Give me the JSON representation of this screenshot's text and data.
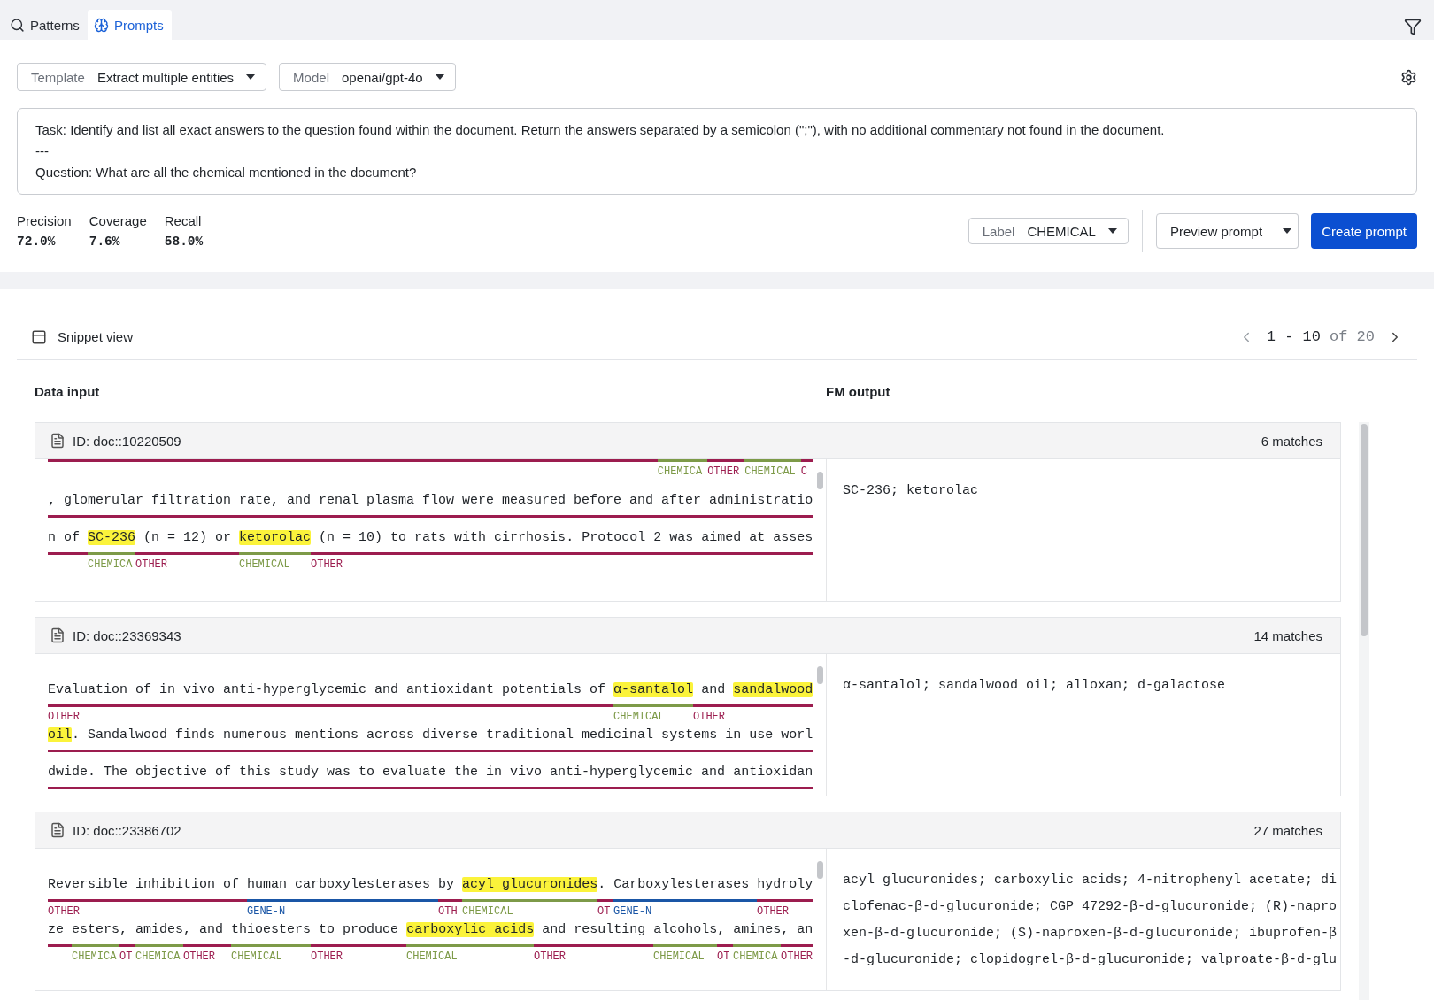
{
  "tabs": [
    {
      "label": "Patterns",
      "selected": false
    },
    {
      "label": "Prompts",
      "selected": true
    }
  ],
  "selectors": [
    {
      "label": "Template",
      "value": "Extract multiple entities"
    },
    {
      "label": "Model",
      "value": "openai/gpt-4o"
    }
  ],
  "prompt": {
    "lines": [
      "Task: Identify and list all exact answers to the question found within the document. Return the answers separated by a semicolon (\";\"), with no additional commentary not found in the document.",
      "---",
      "Question: What are all the chemical mentioned in the document?"
    ]
  },
  "metrics": [
    {
      "name": "Precision",
      "value": "72.0%"
    },
    {
      "name": "Coverage",
      "value": "7.6%"
    },
    {
      "name": "Recall",
      "value": "58.0%"
    }
  ],
  "label_selector": {
    "label": "Label",
    "value": "CHEMICAL"
  },
  "preview_button": "Preview prompt",
  "create_button": "Create prompt",
  "snippet_view": "Snippet view",
  "pagination": {
    "range": "1 - 10",
    "total": "of 20"
  },
  "columns": [
    "Data input",
    "FM output"
  ],
  "docs": [
    {
      "id": "ID: doc::10220509",
      "matches": "6 matches",
      "lines": [
        {
          "kind": "tags",
          "spans": [
            {
              "color": "#9c1d4f"
            },
            {
              "label": "CHEMICA",
              "color": "#7d9a48"
            },
            {
              "label": "OTHER",
              "color": "#9c1d4f"
            },
            {
              "label": "CHEMICAL",
              "color": "#7d9a48"
            },
            {
              "label": "C",
              "color": "#9c1d4f"
            }
          ]
        },
        {
          "kind": "text",
          "segments": [
            {
              "text": ", glomerular filtration rate, and renal plasma flow were measured before and after administratio",
              "color": "#9c1d4f",
              "highlight": false
            }
          ]
        },
        {
          "kind": "text",
          "segments": [
            {
              "text": "n of ",
              "color": "#9c1d4f",
              "highlight": false
            },
            {
              "text": "SC-236",
              "color": "#7d9a48",
              "label": "CHEMICA",
              "highlight": true
            },
            {
              "text": " (n = 12) or ",
              "color": "#9c1d4f",
              "label": "OTHER",
              "highlight": false
            },
            {
              "text": "ketorolac",
              "color": "#7d9a48",
              "label": "CHEMICAL",
              "highlight": true
            },
            {
              "text": " (n = 10) to rats with cirrhosis. Protocol 2 was aimed at asses",
              "color": "#9c1d4f",
              "label": "OTHER",
              "highlight": false
            }
          ]
        }
      ],
      "output": [
        "SC-236; ketorolac"
      ]
    },
    {
      "id": "ID: doc::23369343",
      "matches": "14 matches",
      "lines": [
        {
          "kind": "text",
          "segments": [
            {
              "text": "Evaluation of in vivo anti-hyperglycemic and antioxidant potentials of ",
              "color": "#9c1d4f",
              "label": "OTHER",
              "highlight": false
            },
            {
              "text": "α-santalol",
              "color": "#7d9a48",
              "label": "CHEMICAL",
              "highlight": true
            },
            {
              "text": " and ",
              "color": "#9c1d4f",
              "label": "OTHER",
              "highlight": false
            },
            {
              "text": "sandalwood",
              "color": "#9c1d4f",
              "highlight": true
            }
          ]
        },
        {
          "kind": "text",
          "segments": [
            {
              "text": "oil",
              "color": "#9c1d4f",
              "highlight": true
            },
            {
              "text": ". Sandalwood finds numerous mentions across diverse traditional medicinal systems in use worl",
              "color": "#9c1d4f",
              "highlight": false
            }
          ]
        },
        {
          "kind": "text",
          "segments": [
            {
              "text": "dwide. The objective of this study was to evaluate the in vivo anti-hyperglycemic and antioxidan",
              "color": "#9c1d4f",
              "highlight": false
            }
          ]
        }
      ],
      "output": [
        "α-santalol; sandalwood oil; alloxan; d-galactose"
      ]
    },
    {
      "id": "ID: doc::23386702",
      "matches": "27 matches",
      "lines": [
        {
          "kind": "text",
          "segments": [
            {
              "text": "Reversible inhibition of ",
              "color": "#9c1d4f",
              "label": "OTHER",
              "highlight": false
            },
            {
              "text": "human carboxylesterases ",
              "color": "#1a56a6",
              "label": "GENE-N",
              "highlight": false
            },
            {
              "text": "by ",
              "color": "#9c1d4f",
              "label": "OTH",
              "highlight": false
            },
            {
              "text": "acyl glucuronides",
              "color": "#7d9a48",
              "label": "CHEMICAL",
              "highlight": true
            },
            {
              "text": ". ",
              "color": "#9c1d4f",
              "label": "OT",
              "highlight": false
            },
            {
              "text": "Carboxylesterases ",
              "color": "#1a56a6",
              "label": "GENE-N",
              "highlight": false
            },
            {
              "text": "hydroly",
              "color": "#9c1d4f",
              "label": "OTHER",
              "highlight": false
            }
          ]
        },
        {
          "kind": "text",
          "segments": [
            {
              "text": "ze ",
              "color": "#9c1d4f",
              "highlight": false
            },
            {
              "text": "esters",
              "color": "#7d9a48",
              "label": "CHEMICA",
              "highlight": false
            },
            {
              "text": ", ",
              "color": "#9c1d4f",
              "label": "OT",
              "highlight": false
            },
            {
              "text": "amides",
              "color": "#7d9a48",
              "label": "CHEMICA",
              "highlight": false
            },
            {
              "text": ", and ",
              "color": "#9c1d4f",
              "label": "OTHER",
              "highlight": false
            },
            {
              "text": "thioesters",
              "color": "#7d9a48",
              "label": "CHEMICAL",
              "highlight": false
            },
            {
              "text": " to produce ",
              "color": "#9c1d4f",
              "label": "OTHER",
              "highlight": false
            },
            {
              "text": "carboxylic acids",
              "color": "#7d9a48",
              "label": "CHEMICAL",
              "highlight": true
            },
            {
              "text": " and resulting ",
              "color": "#9c1d4f",
              "label": "OTHER",
              "highlight": false
            },
            {
              "text": "alcohols",
              "color": "#7d9a48",
              "label": "CHEMICAL",
              "highlight": false
            },
            {
              "text": ", ",
              "color": "#9c1d4f",
              "label": "OT",
              "highlight": false
            },
            {
              "text": "amines",
              "color": "#7d9a48",
              "label": "CHEMICA",
              "highlight": false
            },
            {
              "text": ", an",
              "color": "#9c1d4f",
              "label": "OTHER",
              "highlight": false
            }
          ]
        }
      ],
      "output": [
        "acyl glucuronides; carboxylic acids; 4-nitrophenyl acetate; di",
        "clofenac-β-d-glucuronide; CGP 47292-β-d-glucuronide; (R)-napro",
        "xen-β-d-glucuronide; (S)-naproxen-β-d-glucuronide; ibuprofen-β",
        "-d-glucuronide; clopidogrel-β-d-glucuronide; valproate-β-d-glu"
      ]
    }
  ]
}
